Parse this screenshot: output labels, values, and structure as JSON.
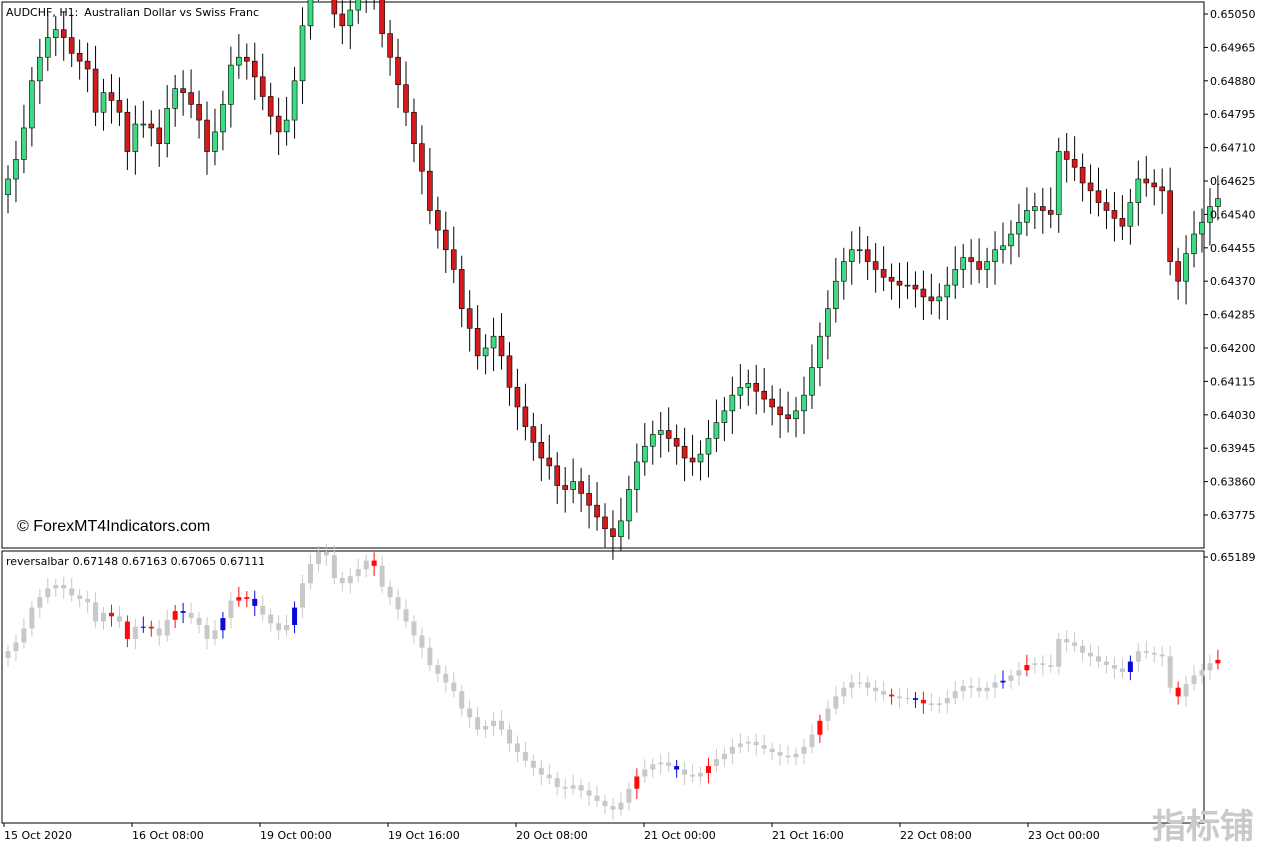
{
  "header": {
    "symbol": "AUDCHF, H1:",
    "description": "Australian Dollar vs Swiss Franc"
  },
  "copyright": "© ForexMT4Indicators.com",
  "indicator": {
    "name": "reversalbar",
    "values": "0.67148 0.67163 0.67065 0.67111"
  },
  "watermark": "指标铺",
  "colors": {
    "bull": "#3ddc84",
    "bear": "#d41a1a",
    "neutral": "#c8c8c8",
    "reversal_bull": "#0a0ad8",
    "reversal_bear": "#ff0a0a"
  },
  "chart_data": [
    {
      "type": "candlestick",
      "ylim": [
        0.6371,
        0.6508
      ],
      "y_ticks": [
        "0.65050",
        "0.64965",
        "0.64880",
        "0.64795",
        "0.64710",
        "0.64625",
        "0.64540",
        "0.64455",
        "0.64370",
        "0.64285",
        "0.64200",
        "0.64115",
        "0.64030",
        "0.63945",
        "0.63860",
        "0.63775"
      ],
      "x_ticks": [
        "15 Oct 2020",
        "16 Oct 08:00",
        "19 Oct 00:00",
        "19 Oct 16:00",
        "20 Oct 08:00",
        "21 Oct 00:00",
        "21 Oct 16:00",
        "22 Oct 08:00",
        "23 Oct 00:00"
      ],
      "grid": false,
      "closes": [
        0.6463,
        0.6468,
        0.6476,
        0.6488,
        0.6494,
        0.6499,
        0.6501,
        0.6499,
        0.6495,
        0.6493,
        0.6491,
        0.648,
        0.6485,
        0.6483,
        0.648,
        0.647,
        0.6477,
        0.6477,
        0.6476,
        0.6472,
        0.6481,
        0.6486,
        0.6485,
        0.6482,
        0.6478,
        0.647,
        0.6475,
        0.6482,
        0.6492,
        0.6494,
        0.6493,
        0.6489,
        0.6484,
        0.6479,
        0.6475,
        0.6478,
        0.6488,
        0.6502,
        0.6513,
        0.652,
        0.6518,
        0.6505,
        0.6502,
        0.6506,
        0.651,
        0.6515,
        0.6512,
        0.65,
        0.6494,
        0.6487,
        0.648,
        0.6472,
        0.6465,
        0.6455,
        0.645,
        0.6445,
        0.644,
        0.643,
        0.6425,
        0.6418,
        0.642,
        0.6423,
        0.6418,
        0.641,
        0.6405,
        0.64,
        0.6396,
        0.6392,
        0.639,
        0.6385,
        0.6384,
        0.6386,
        0.6383,
        0.638,
        0.6377,
        0.6374,
        0.6372,
        0.6376,
        0.6384,
        0.6391,
        0.6395,
        0.6398,
        0.6399,
        0.6397,
        0.6395,
        0.6392,
        0.6391,
        0.6393,
        0.6397,
        0.6401,
        0.6404,
        0.6408,
        0.641,
        0.6411,
        0.6409,
        0.6407,
        0.6405,
        0.6403,
        0.6402,
        0.6404,
        0.6408,
        0.6415,
        0.6423,
        0.643,
        0.6437,
        0.6442,
        0.6445,
        0.6445,
        0.6442,
        0.644,
        0.6438,
        0.6437,
        0.6436,
        0.6436,
        0.6435,
        0.6433,
        0.6432,
        0.6433,
        0.6436,
        0.644,
        0.6443,
        0.6442,
        0.644,
        0.6442,
        0.6445,
        0.6446,
        0.6449,
        0.6452,
        0.6455,
        0.6456,
        0.6455,
        0.6454,
        0.647,
        0.6468,
        0.6466,
        0.6462,
        0.646,
        0.6457,
        0.6455,
        0.6453,
        0.6451,
        0.6457,
        0.6463,
        0.6462,
        0.6461,
        0.646,
        0.6442,
        0.6437,
        0.6444,
        0.6449,
        0.6452,
        0.6456,
        0.6458
      ],
      "series": [
        {
          "name": "candles",
          "values": [
            0.6463,
            0.6468,
            0.6476,
            0.6488,
            0.6494,
            0.6499,
            0.6501,
            0.6499,
            0.6495,
            0.6493,
            0.6491,
            0.648,
            0.6485,
            0.6483,
            0.648,
            0.647,
            0.6477,
            0.6477,
            0.6476,
            0.6472,
            0.6481,
            0.6486,
            0.6485,
            0.6482,
            0.6478,
            0.647,
            0.6475,
            0.6482,
            0.6492,
            0.6494,
            0.6493,
            0.6489,
            0.6484,
            0.6479,
            0.6475,
            0.6478,
            0.6488,
            0.6502,
            0.6513,
            0.652,
            0.6518,
            0.6505,
            0.6502,
            0.6506,
            0.651,
            0.6515,
            0.6512,
            0.65,
            0.6494,
            0.6487,
            0.648,
            0.6472,
            0.6465,
            0.6455,
            0.645,
            0.6445,
            0.644,
            0.643,
            0.6425,
            0.6418,
            0.642,
            0.6423,
            0.6418,
            0.641,
            0.6405,
            0.64,
            0.6396,
            0.6392,
            0.639,
            0.6385,
            0.6384,
            0.6386,
            0.6383,
            0.638,
            0.6377,
            0.6374,
            0.6372,
            0.6376,
            0.6384,
            0.6391,
            0.6395,
            0.6398,
            0.6399,
            0.6397,
            0.6395,
            0.6392,
            0.6391,
            0.6393,
            0.6397,
            0.6401,
            0.6404,
            0.6408,
            0.641,
            0.6411,
            0.6409,
            0.6407,
            0.6405,
            0.6403,
            0.6402,
            0.6404,
            0.6408,
            0.6415,
            0.6423,
            0.643,
            0.6437,
            0.6442,
            0.6445,
            0.6445,
            0.6442,
            0.644,
            0.6438,
            0.6437,
            0.6436,
            0.6436,
            0.6435,
            0.6433,
            0.6432,
            0.6433,
            0.6436,
            0.644,
            0.6443,
            0.6442,
            0.644,
            0.6442,
            0.6445,
            0.6446,
            0.6449,
            0.6452,
            0.6455,
            0.6456,
            0.6455,
            0.6454,
            0.647,
            0.6468,
            0.6466,
            0.6462,
            0.646,
            0.6457,
            0.6455,
            0.6453,
            0.6451,
            0.6457,
            0.6463,
            0.6462,
            0.6461,
            0.646,
            0.6442,
            0.6437,
            0.6444,
            0.6449,
            0.6452,
            0.6456,
            0.6458
          ]
        }
      ]
    },
    {
      "type": "candlestick",
      "y_ticks": [
        "0.65189"
      ],
      "reversal_bars": {
        "bull": [
          17,
          22,
          27,
          31,
          36,
          84,
          114,
          125,
          141
        ],
        "bear": [
          13,
          15,
          18,
          21,
          29,
          30,
          46,
          79,
          88,
          102,
          111,
          115,
          128,
          147,
          152,
          158
        ]
      }
    }
  ]
}
